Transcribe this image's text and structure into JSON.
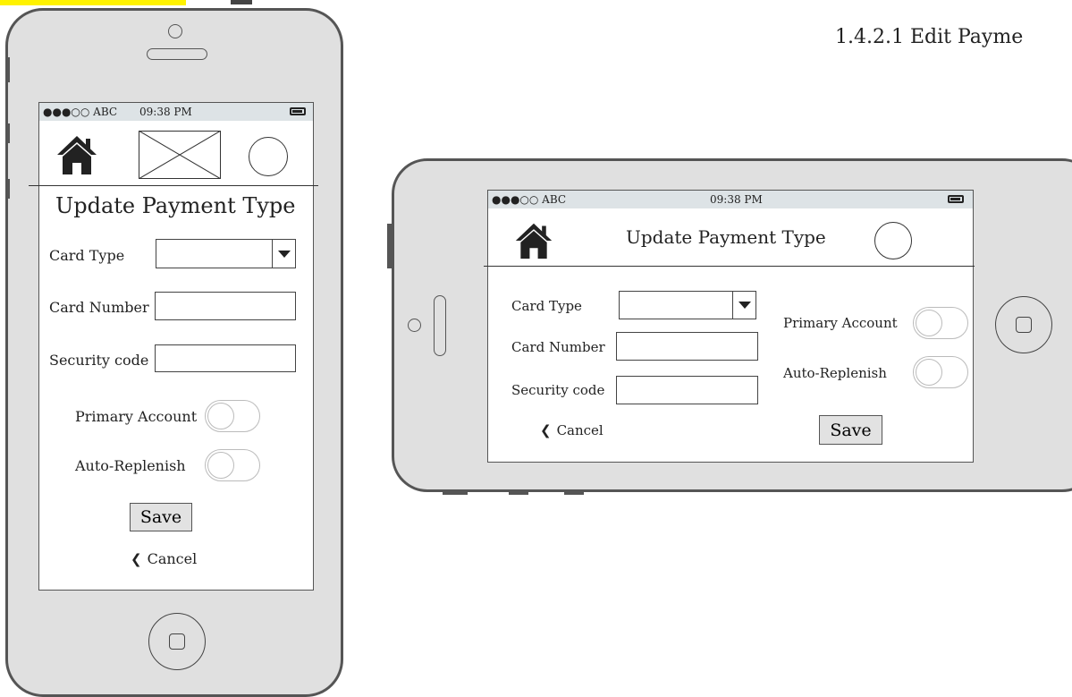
{
  "page": {
    "section_title": "1.4.2.1 Edit Payme"
  },
  "status": {
    "carrier": "●●●○○ ABC",
    "time": "09:38 PM"
  },
  "form": {
    "heading": "Update Payment Type",
    "card_type_label": "Card Type",
    "card_number_label": "Card Number",
    "security_code_label": "Security code",
    "primary_account_label": "Primary Account",
    "auto_replenish_label": "Auto-Replenish",
    "save_label": "Save",
    "cancel_label": "Cancel"
  },
  "icons": {
    "home": "home-icon",
    "image_placeholder": "image-placeholder-icon",
    "profile": "circle-icon",
    "cancel": "chevron-left-icon",
    "dropdown": "caret-down-icon"
  },
  "colors": {
    "highlight": "#fff200",
    "device_body": "#e0e0e0",
    "status_bar": "#dde3e6",
    "button": "#e2e2e2"
  }
}
